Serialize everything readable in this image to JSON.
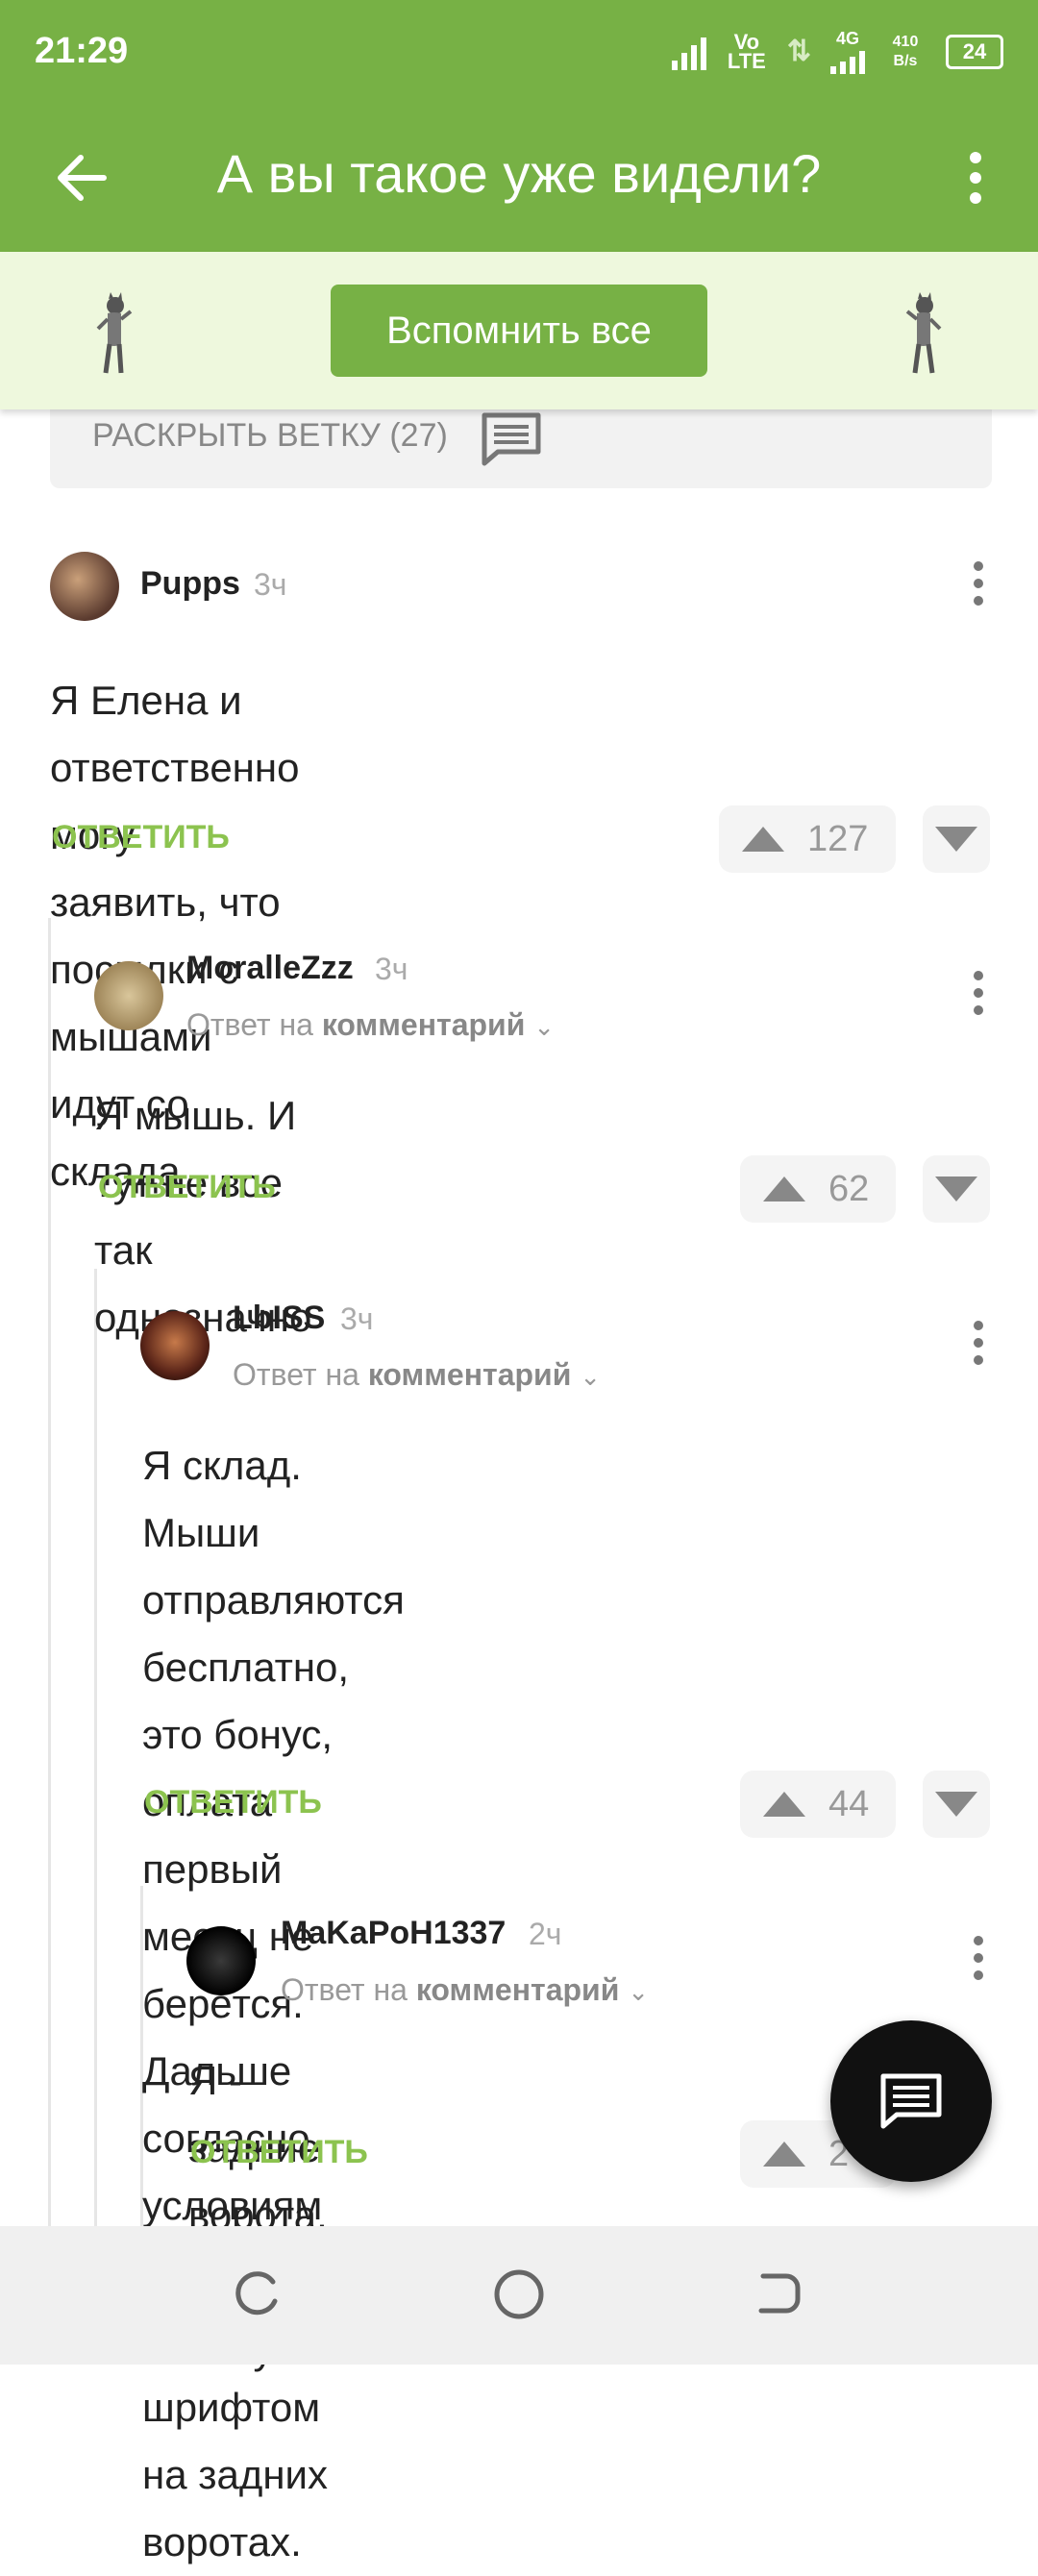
{
  "status_bar": {
    "time": "21:29",
    "network": "Vo LTE",
    "net_type": "4G",
    "speed": "410 B/s",
    "battery": "24"
  },
  "app_bar": {
    "title": "А вы такое уже видели?"
  },
  "banner": {
    "button_label": "Вспомнить все"
  },
  "expand_branch": {
    "label": "РАСКРЫТЬ ВЕТКУ (27)"
  },
  "comments": [
    {
      "user": "Pupps",
      "time": "3ч",
      "text_lines": [
        "Я Елена и ответственно могу заявить, что",
        "посылки с мышами идут со склада"
      ],
      "reply_label": "ОТВЕТИТЬ",
      "votes": "127"
    },
    {
      "user": "MoralleZzz",
      "time": "3ч",
      "reply_to_prefix": "Ответ на",
      "reply_to_target": "комментарий",
      "text_lines": [
        "Я мышь. И тут не все так однозначно"
      ],
      "reply_label": "ОТВЕТИТЬ",
      "votes": "62"
    },
    {
      "user": "LbISS",
      "time": "3ч",
      "reply_to_prefix": "Ответ на",
      "reply_to_target": "комментарий",
      "text_lines": [
        "Я склад. Мыши отправляются",
        "бесплатно, это бонус, оплата первый",
        "месяц не берётся. Дальше согласно",
        "условиям подписки мелким шрифтом",
        "на задних воротах."
      ],
      "reply_label": "ОТВЕТИТЬ",
      "votes": "44"
    },
    {
      "user": "MaKaPoH1337",
      "time": "2ч",
      "reply_to_prefix": "Ответ на",
      "reply_to_target": "комментарий",
      "text_lines": [
        "Я - задние ворота. Идите наху"
      ],
      "reply_label": "ОТВЕТИТЬ",
      "votes": "2"
    }
  ],
  "colors": {
    "brand_green": "#77b145",
    "reply_green": "#8cc34f",
    "banner_bg": "#eef8dd"
  }
}
